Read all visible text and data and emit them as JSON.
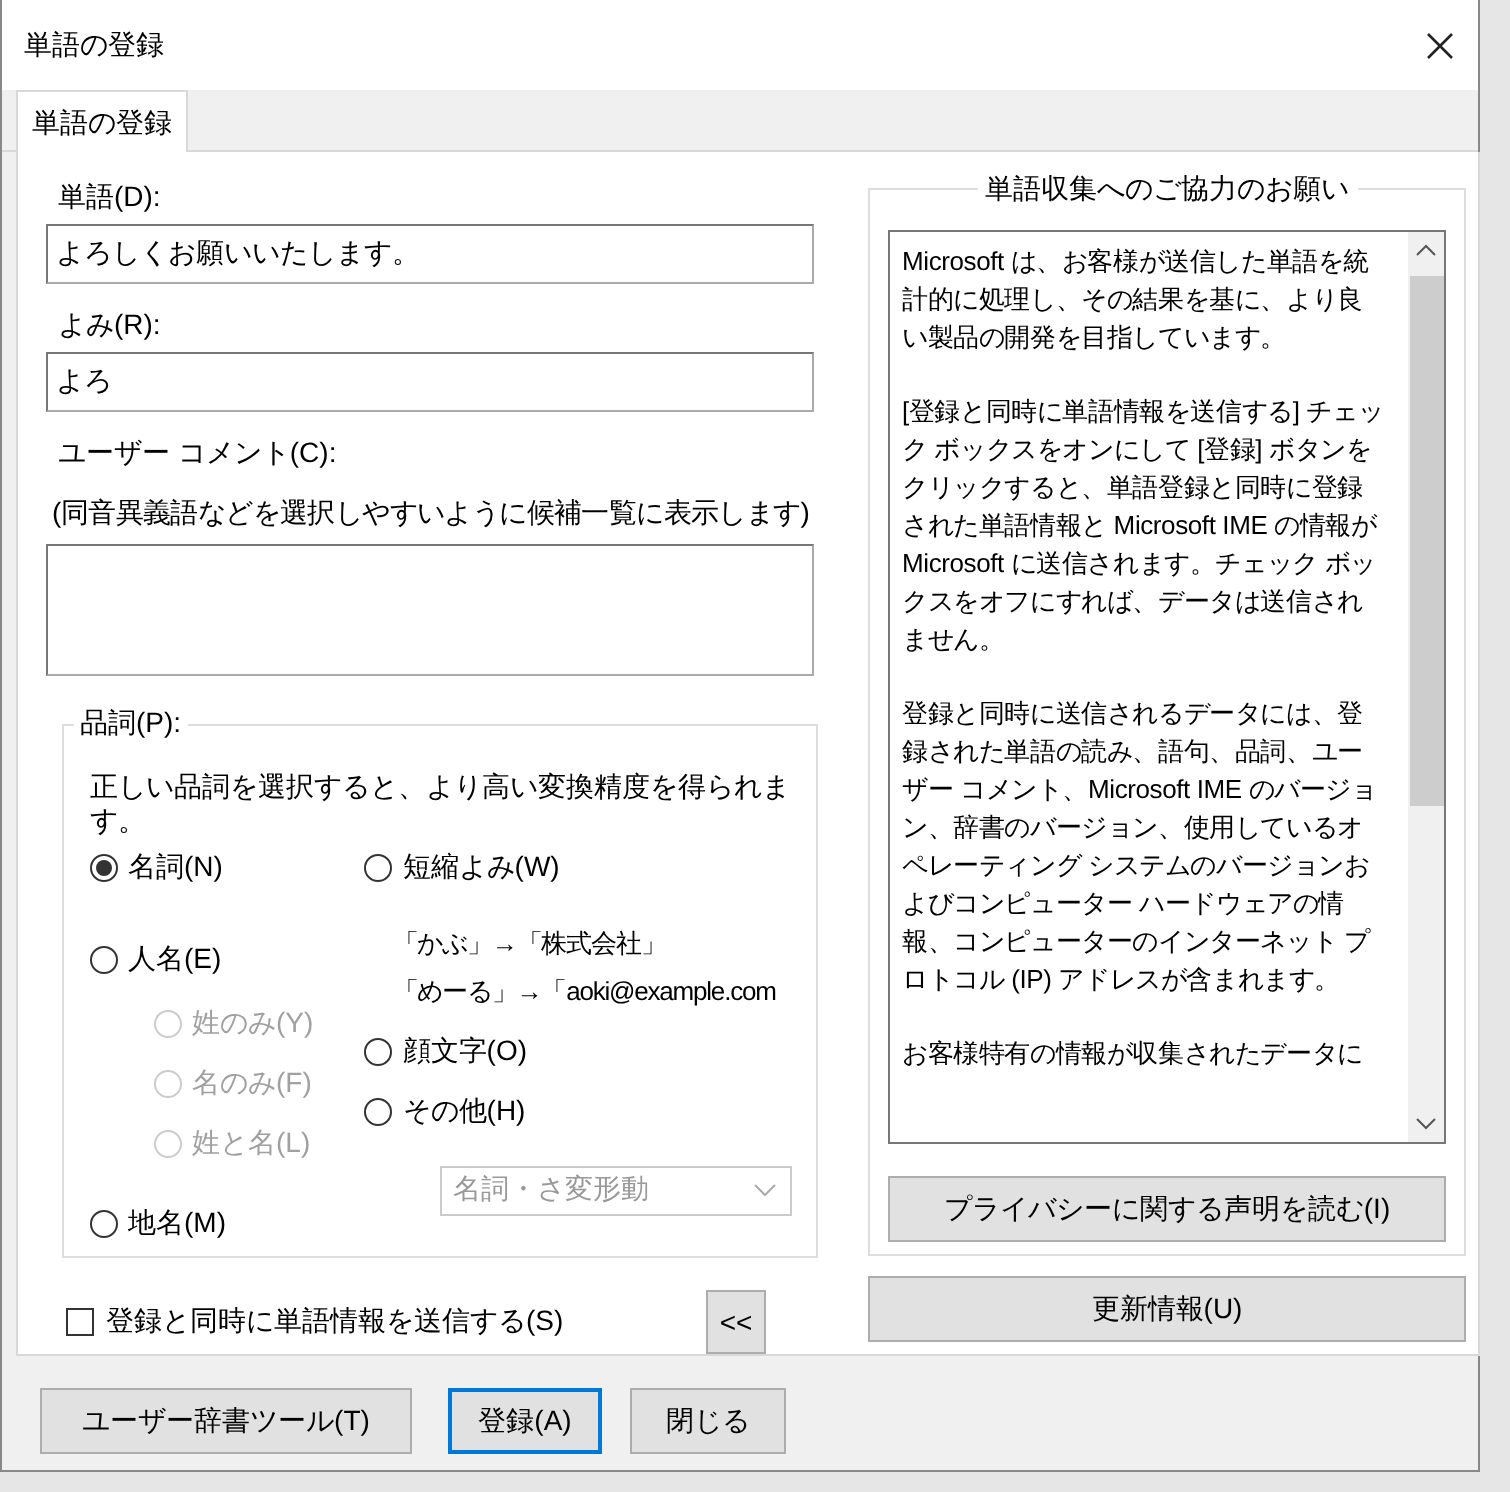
{
  "window": {
    "title": "単語の登録"
  },
  "tabs": [
    {
      "label": "単語の登録",
      "selected": true
    }
  ],
  "word": {
    "label": "単語(D):",
    "value": "よろしくお願いいたします。"
  },
  "reading": {
    "label": "よみ(R):",
    "value": "よろ"
  },
  "comment": {
    "label": "ユーザー コメント(C):",
    "hint": "(同音異義語などを選択しやすいように候補一覧に表示します)"
  },
  "part_of_speech": {
    "legend": "品詞(P):",
    "description": "正しい品詞を選択すると、より高い変換精度を得られます。",
    "left_options": [
      {
        "label": "名詞(N)",
        "selected": true,
        "disabled": false
      },
      {
        "label": "人名(E)",
        "selected": false,
        "disabled": false,
        "children": [
          {
            "label": "姓のみ(Y)",
            "selected": false,
            "disabled": true
          },
          {
            "label": "名のみ(F)",
            "selected": false,
            "disabled": true
          },
          {
            "label": "姓と名(L)",
            "selected": false,
            "disabled": true
          }
        ]
      },
      {
        "label": "地名(M)",
        "selected": false,
        "disabled": false
      }
    ],
    "right_options": [
      {
        "label": "短縮よみ(W)",
        "selected": false,
        "disabled": false
      },
      {
        "label": "顔文字(O)",
        "selected": false,
        "disabled": false
      },
      {
        "label": "その他(H)",
        "selected": false,
        "disabled": false
      }
    ],
    "examples": [
      "「かぶ」→「株式会社」",
      "「めーる」→「aoki@example.com"
    ],
    "dropdown": {
      "value": "名詞・さ変形動",
      "disabled": true
    }
  },
  "send_checkbox": {
    "label": "登録と同時に単語情報を送信する(S)",
    "checked": false
  },
  "collapse_button": "<<",
  "cooperation": {
    "legend": "単語収集へのご協力のお願い",
    "paragraphs": [
      "Microsoft は、お客様が送信した単語を統計的に処理し、その結果を基に、より良い製品の開発を目指しています。",
      "[登録と同時に単語情報を送信する] チェック ボックスをオンにして [登録] ボタンをクリックすると、単語登録と同時に登録された単語情報と Microsoft IME の情報が Microsoft に送信されます。チェック ボックスをオフにすれば、データは送信されません。",
      "登録と同時に送信されるデータには、登録された単語の読み、語句、品詞、ユーザー コメント、Microsoft IME のバージョン、辞書のバージョン、使用しているオペレーティング システムのバージョンおよびコンピューター ハードウェアの情報、コンピューターのインターネット プロトコル (IP) アドレスが含まれます。",
      "お客様特有の情報が収集されたデータに"
    ],
    "privacy_button": "プライバシーに関する声明を読む(I)"
  },
  "update_button": "更新情報(U)",
  "footer_buttons": [
    {
      "label": "ユーザー辞書ツール(T)",
      "default": false
    },
    {
      "label": "登録(A)",
      "default": true
    },
    {
      "label": "閉じる",
      "default": false
    }
  ]
}
